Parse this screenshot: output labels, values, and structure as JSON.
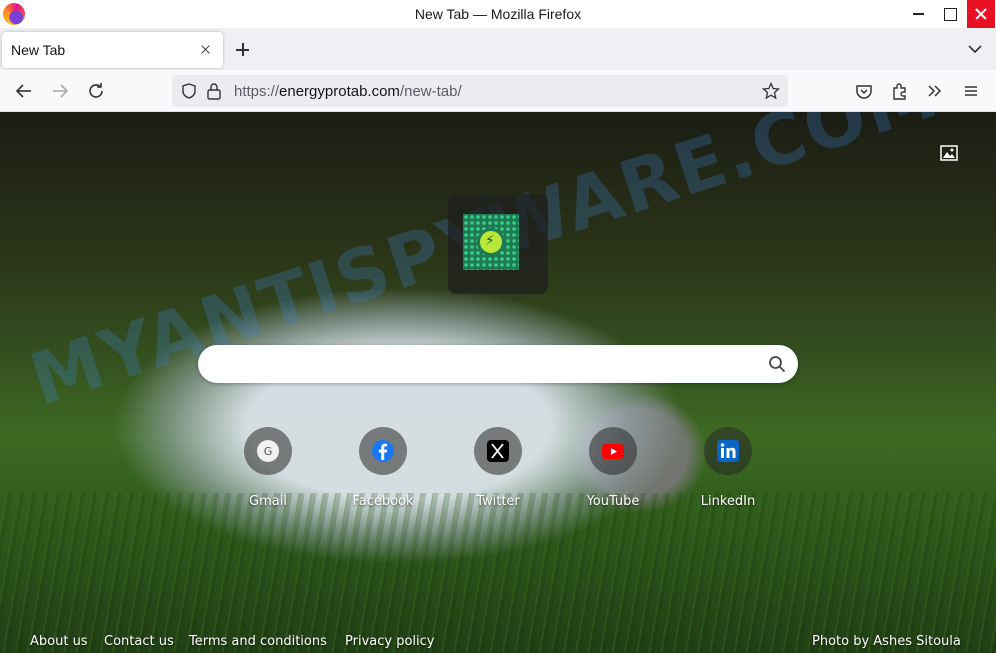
{
  "window": {
    "title": "New Tab — Mozilla Firefox"
  },
  "tabs": [
    {
      "label": "New Tab",
      "active": true
    }
  ],
  "urlbar": {
    "scheme": "https://",
    "host": "energyprotab.com",
    "path": "/new-tab/"
  },
  "page": {
    "watermark": "MYANTISPYWARE.COM",
    "search": {
      "value": "",
      "placeholder": ""
    },
    "shortcuts": [
      {
        "label": "Gmail",
        "icon": "gmail-icon"
      },
      {
        "label": "Facebook",
        "icon": "facebook-icon"
      },
      {
        "label": "Twitter",
        "icon": "twitter-x-icon"
      },
      {
        "label": "YouTube",
        "icon": "youtube-icon"
      },
      {
        "label": "LinkedIn",
        "icon": "linkedin-icon"
      }
    ],
    "footer": {
      "links": [
        "About us",
        "Contact us",
        "Terms and conditions",
        "Privacy policy"
      ],
      "photo_credit": "Photo by Ashes Sitoula"
    }
  },
  "colors": {
    "close_button": "#e81123",
    "facebook": "#1877f2",
    "youtube": "#ff0000",
    "linkedin": "#0a66c2"
  }
}
